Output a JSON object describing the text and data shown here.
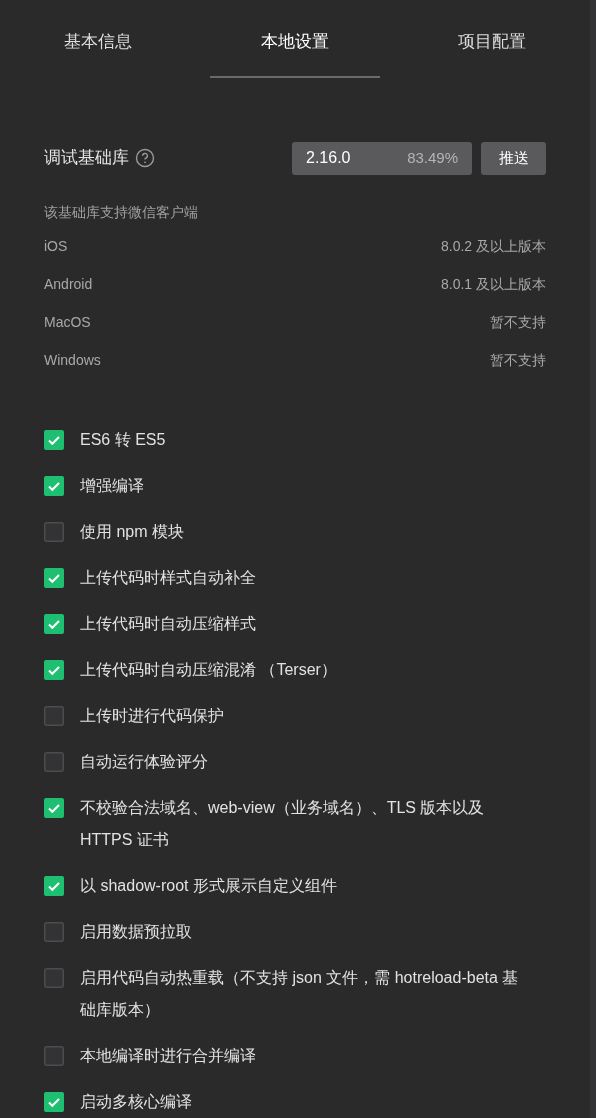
{
  "tabs": [
    {
      "label": "基本信息",
      "selected": false
    },
    {
      "label": "本地设置",
      "selected": true
    },
    {
      "label": "项目配置",
      "selected": false
    }
  ],
  "debug_library": {
    "label": "调试基础库",
    "version": "2.16.0",
    "usage": "83.49%",
    "push_button": "推送"
  },
  "support": {
    "heading": "该基础库支持微信客户端",
    "rows": [
      {
        "platform": "iOS",
        "requirement": "8.0.2 及以上版本"
      },
      {
        "platform": "Android",
        "requirement": "8.0.1 及以上版本"
      },
      {
        "platform": "MacOS",
        "requirement": "暂不支持"
      },
      {
        "platform": "Windows",
        "requirement": "暂不支持"
      }
    ]
  },
  "options": [
    {
      "label": "ES6 转 ES5",
      "checked": true
    },
    {
      "label": "增强编译",
      "checked": true
    },
    {
      "label": "使用 npm 模块",
      "checked": false
    },
    {
      "label": "上传代码时样式自动补全",
      "checked": true
    },
    {
      "label": "上传代码时自动压缩样式",
      "checked": true
    },
    {
      "label": "上传代码时自动压缩混淆 （Terser）",
      "checked": true
    },
    {
      "label": "上传时进行代码保护",
      "checked": false
    },
    {
      "label": "自动运行体验评分",
      "checked": false
    },
    {
      "label": "不校验合法域名、web-view（业务域名）、TLS 版本以及 HTTPS 证书",
      "checked": true
    },
    {
      "label": "以 shadow-root 形式展示自定义组件",
      "checked": true
    },
    {
      "label": "启用数据预拉取",
      "checked": false
    },
    {
      "label": "启用代码自动热重载（不支持 json 文件，需 hotreload-beta 基础库版本）",
      "checked": false
    },
    {
      "label": "本地编译时进行合并编译",
      "checked": false
    },
    {
      "label": "启动多核心编译",
      "checked": true
    }
  ]
}
